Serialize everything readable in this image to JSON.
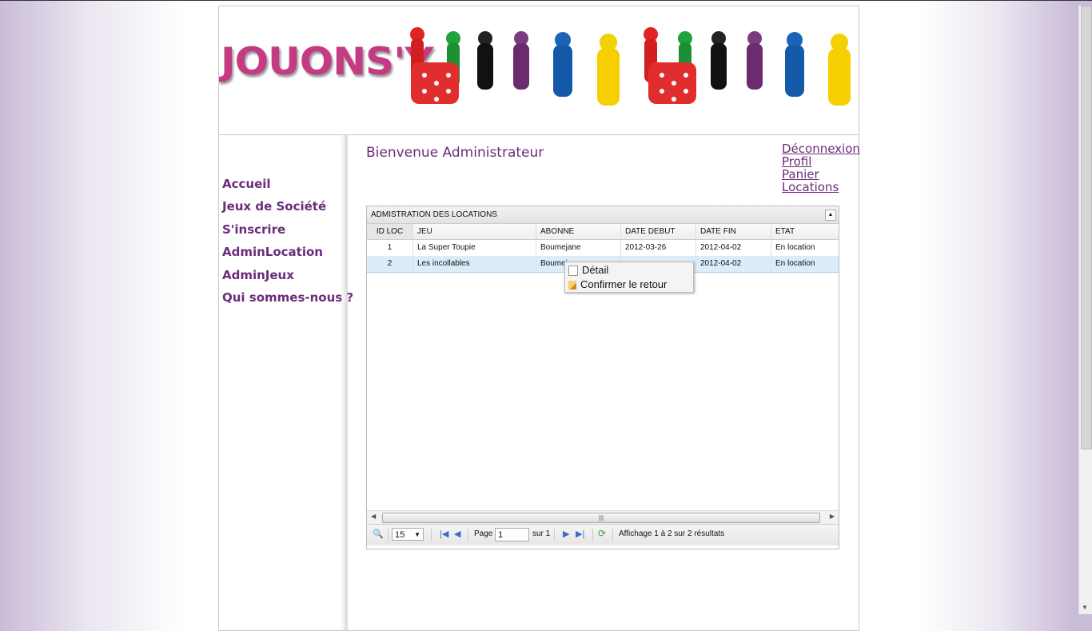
{
  "banner": {
    "logo": "JOUONS'Y"
  },
  "nav": {
    "items": [
      "Accueil",
      "Jeux de Société",
      "S'inscrire",
      "AdminLocation",
      "AdminJeux",
      "Qui sommes-nous ?"
    ]
  },
  "welcome": "Bienvenue Administrateur",
  "toplinks": [
    "Déconnexion",
    "Profil",
    "Panier",
    "Locations"
  ],
  "grid": {
    "title": "ADMISTRATION DES LOCATIONS",
    "columns": [
      "ID LOC",
      "JEU",
      "ABONNE",
      "DATE DEBUT",
      "DATE FIN",
      "ETAT"
    ],
    "rows": [
      [
        "1",
        "La Super Toupie",
        "Boumejane",
        "2012-03-26",
        "2012-04-02",
        "En location"
      ],
      [
        "2",
        "Les incollables",
        "Boumej",
        "",
        "2012-04-02",
        "En location"
      ]
    ],
    "pager": {
      "rows_per_page": "15",
      "page_label": "Page",
      "page_value": "1",
      "of_label": "sur 1",
      "summary": "Affichage 1 à 2 sur 2 résultats"
    }
  },
  "context_menu": [
    "Détail",
    "Confirmer le retour"
  ],
  "colors": {
    "accent": "#6b2c7a",
    "selected_row": "#dcecf8"
  }
}
